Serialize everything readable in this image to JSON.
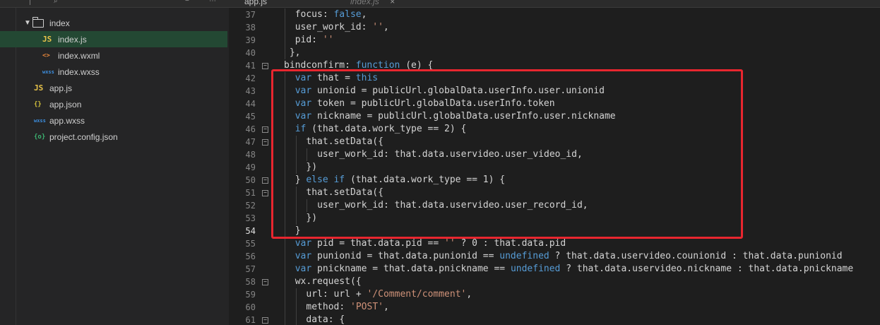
{
  "topbar": {
    "tabs": [
      {
        "label": "app.js"
      },
      {
        "label": "index.js"
      }
    ]
  },
  "sidebar": {
    "items": [
      {
        "label": "index",
        "icon": "folder-icon",
        "type": "folder"
      },
      {
        "label": "index.js",
        "icon": "JS",
        "type": "js",
        "selected": true
      },
      {
        "label": "index.wxml",
        "icon": "<>",
        "type": "wxml"
      },
      {
        "label": "index.wxss",
        "icon": "wxss",
        "type": "wxss"
      },
      {
        "label": "app.js",
        "icon": "JS",
        "type": "js"
      },
      {
        "label": "app.json",
        "icon": "{}",
        "type": "json"
      },
      {
        "label": "app.wxss",
        "icon": "wxss",
        "type": "wxss"
      },
      {
        "label": "project.config.json",
        "icon": "{o}",
        "type": "config"
      }
    ]
  },
  "editor": {
    "current_line": 54,
    "lines": [
      {
        "n": 37,
        "indent": 2,
        "fold": false,
        "tokens": [
          [
            "p",
            "focus: "
          ],
          [
            "k",
            "false"
          ],
          [
            "p",
            ","
          ]
        ]
      },
      {
        "n": 38,
        "indent": 2,
        "fold": false,
        "tokens": [
          [
            "p",
            "user_work_id: "
          ],
          [
            "s",
            "''"
          ],
          [
            "p",
            ","
          ]
        ]
      },
      {
        "n": 39,
        "indent": 2,
        "fold": false,
        "tokens": [
          [
            "p",
            "pid: "
          ],
          [
            "s",
            "''"
          ]
        ]
      },
      {
        "n": 40,
        "indent": 1,
        "fold": false,
        "tokens": [
          [
            "p",
            "},"
          ]
        ]
      },
      {
        "n": 41,
        "indent": 0,
        "fold": true,
        "tokens": [
          [
            "p",
            "bindconfirm: "
          ],
          [
            "k",
            "function"
          ],
          [
            "p",
            " (e) {"
          ]
        ]
      },
      {
        "n": 42,
        "indent": 2,
        "fold": false,
        "tokens": [
          [
            "k",
            "var"
          ],
          [
            "p",
            " that = "
          ],
          [
            "k",
            "this"
          ]
        ]
      },
      {
        "n": 43,
        "indent": 2,
        "fold": false,
        "tokens": [
          [
            "k",
            "var"
          ],
          [
            "p",
            " unionid = publicUrl.globalData.userInfo.user.unionid"
          ]
        ]
      },
      {
        "n": 44,
        "indent": 2,
        "fold": false,
        "tokens": [
          [
            "k",
            "var"
          ],
          [
            "p",
            " token = publicUrl.globalData.userInfo.token"
          ]
        ]
      },
      {
        "n": 45,
        "indent": 2,
        "fold": false,
        "tokens": [
          [
            "k",
            "var"
          ],
          [
            "p",
            " nickname = publicUrl.globalData.userInfo.user.nickname"
          ]
        ]
      },
      {
        "n": 46,
        "indent": 2,
        "fold": true,
        "tokens": [
          [
            "k",
            "if"
          ],
          [
            "p",
            " (that.data.work_type == 2) {"
          ]
        ]
      },
      {
        "n": 47,
        "indent": 4,
        "fold": true,
        "tokens": [
          [
            "p",
            "that.setData({"
          ]
        ]
      },
      {
        "n": 48,
        "indent": 6,
        "fold": false,
        "tokens": [
          [
            "p",
            "user_work_id: that.data.uservideo.user_video_id,"
          ]
        ]
      },
      {
        "n": 49,
        "indent": 4,
        "fold": false,
        "tokens": [
          [
            "p",
            "})"
          ]
        ]
      },
      {
        "n": 50,
        "indent": 2,
        "fold": true,
        "tokens": [
          [
            "p",
            "} "
          ],
          [
            "k",
            "else"
          ],
          [
            "p",
            " "
          ],
          [
            "k",
            "if"
          ],
          [
            "p",
            " (that.data.work_type == 1) {"
          ]
        ]
      },
      {
        "n": 51,
        "indent": 4,
        "fold": true,
        "tokens": [
          [
            "p",
            "that.setData({"
          ]
        ]
      },
      {
        "n": 52,
        "indent": 6,
        "fold": false,
        "tokens": [
          [
            "p",
            "user_work_id: that.data.uservideo.user_record_id,"
          ]
        ]
      },
      {
        "n": 53,
        "indent": 4,
        "fold": false,
        "tokens": [
          [
            "p",
            "})"
          ]
        ]
      },
      {
        "n": 54,
        "indent": 2,
        "fold": false,
        "tokens": [
          [
            "p",
            "}"
          ]
        ]
      },
      {
        "n": 55,
        "indent": 2,
        "fold": false,
        "tokens": [
          [
            "k",
            "var"
          ],
          [
            "p",
            " pid = that.data.pid == "
          ],
          [
            "s",
            "''"
          ],
          [
            "p",
            " ? 0 : that.data.pid"
          ]
        ]
      },
      {
        "n": 56,
        "indent": 2,
        "fold": false,
        "tokens": [
          [
            "k",
            "var"
          ],
          [
            "p",
            " punionid = that.data.punionid == "
          ],
          [
            "k",
            "undefined"
          ],
          [
            "p",
            " ? that.data.uservideo.counionid : that.data.punionid"
          ]
        ]
      },
      {
        "n": 57,
        "indent": 2,
        "fold": false,
        "tokens": [
          [
            "k",
            "var"
          ],
          [
            "p",
            " pnickname = that.data.pnickname == "
          ],
          [
            "k",
            "undefined"
          ],
          [
            "p",
            " ? that.data.uservideo.nickname : that.data.pnickname"
          ]
        ]
      },
      {
        "n": 58,
        "indent": 2,
        "fold": true,
        "tokens": [
          [
            "p",
            "wx.request({"
          ]
        ]
      },
      {
        "n": 59,
        "indent": 4,
        "fold": false,
        "tokens": [
          [
            "p",
            "url: url + "
          ],
          [
            "s",
            "'/Comment/comment'"
          ],
          [
            "p",
            ","
          ]
        ]
      },
      {
        "n": 60,
        "indent": 4,
        "fold": false,
        "tokens": [
          [
            "p",
            "method: "
          ],
          [
            "s",
            "'POST'"
          ],
          [
            "p",
            ","
          ]
        ]
      },
      {
        "n": 61,
        "indent": 4,
        "fold": true,
        "tokens": [
          [
            "p",
            "data: {"
          ]
        ]
      }
    ]
  },
  "colors": {
    "keyword": "#569cd6",
    "string": "#ce9178",
    "plain": "#d4d4d4",
    "highlight_box": "#e8262f",
    "selected_item": "#234833"
  }
}
